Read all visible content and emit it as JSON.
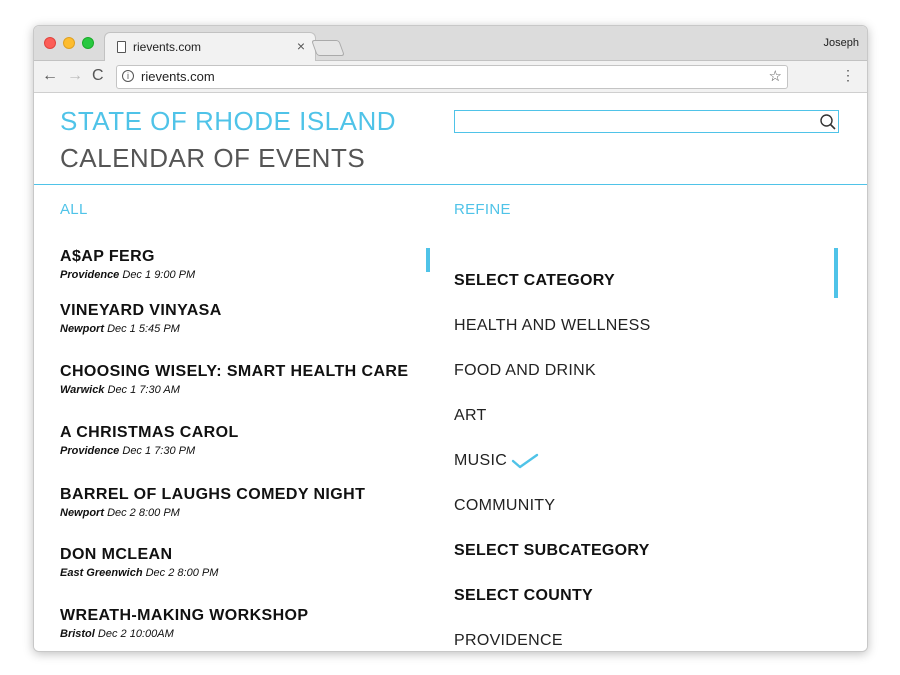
{
  "browser": {
    "tab_title": "rievents.com",
    "tab_close": "×",
    "user_name": "Joseph",
    "url": "rievents.com",
    "back_glyph": "←",
    "forward_glyph": "→",
    "reload_glyph": "C",
    "info_glyph": "i",
    "star_glyph": "☆",
    "menu_glyph": "⋮"
  },
  "header": {
    "state_title": "STATE OF RHODE ISLAND",
    "calendar_title": "CALENDAR OF EVENTS",
    "search_value": ""
  },
  "labels": {
    "all": "ALL",
    "refine": "REFINE"
  },
  "events": [
    {
      "title": "A$AP FERG",
      "city": "Providence",
      "date": "Dec 1",
      "time": "9:00 PM"
    },
    {
      "title": "VINEYARD VINYASA",
      "city": "Newport",
      "date": "Dec 1",
      "time": "5:45 PM"
    },
    {
      "title": "CHOOSING WISELY: SMART HEALTH CARE",
      "city": "Warwick",
      "date": "Dec 1",
      "time": "7:30 AM"
    },
    {
      "title": "A CHRISTMAS CAROL",
      "city": "Providence",
      "date": "Dec 1",
      "time": "7:30 PM"
    },
    {
      "title": "BARREL OF LAUGHS COMEDY NIGHT",
      "city": "Newport",
      "date": "Dec 2",
      "time": "8:00 PM"
    },
    {
      "title": "DON MCLEAN",
      "city": "East Greenwich",
      "date": "Dec 2",
      "time": "8:00 PM"
    },
    {
      "title": "WREATH-MAKING WORKSHOP",
      "city": "Bristol",
      "date": "Dec 2",
      "time": "10:00AM"
    }
  ],
  "refine": [
    {
      "label": "SELECT CATEGORY",
      "heading": true,
      "checked": false
    },
    {
      "label": "HEALTH AND WELLNESS",
      "heading": false,
      "checked": false
    },
    {
      "label": "FOOD AND DRINK",
      "heading": false,
      "checked": false
    },
    {
      "label": "ART",
      "heading": false,
      "checked": false
    },
    {
      "label": "MUSIC",
      "heading": false,
      "checked": true
    },
    {
      "label": "COMMUNITY",
      "heading": false,
      "checked": false
    },
    {
      "label": "SELECT SUBCATEGORY",
      "heading": true,
      "checked": false
    },
    {
      "label": "SELECT COUNTY",
      "heading": true,
      "checked": false
    },
    {
      "label": "PROVIDENCE",
      "heading": false,
      "checked": false
    }
  ],
  "colors": {
    "accent": "#4fc3e8",
    "title_gray": "#555555"
  },
  "icons": {
    "search": "magnifier-icon",
    "check": "checkmark-icon",
    "document": "document-icon"
  }
}
